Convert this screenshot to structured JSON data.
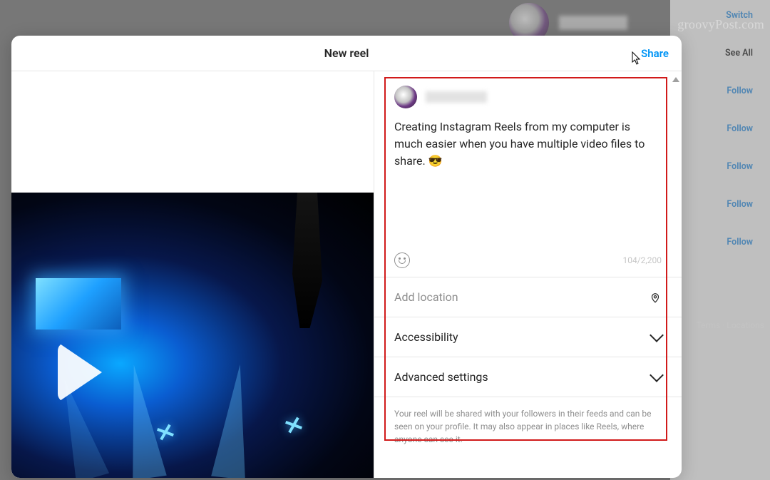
{
  "watermark": "groovyPost.com",
  "background": {
    "switch_label": "Switch",
    "see_all_label": "See All",
    "follow_label": "Follow",
    "footer_links": "Terms · Locations"
  },
  "modal": {
    "title": "New reel",
    "share_label": "Share"
  },
  "caption": {
    "text": "Creating Instagram Reels from my computer is much easier when you have multiple video files to share. 😎",
    "counter": "104/2,200"
  },
  "sections": {
    "location_placeholder": "Add location",
    "accessibility_label": "Accessibility",
    "advanced_label": "Advanced settings"
  },
  "disclaimer": "Your reel will be shared with your followers in their feeds and can be seen on your profile. It may also appear in places like Reels, where anyone can see it."
}
